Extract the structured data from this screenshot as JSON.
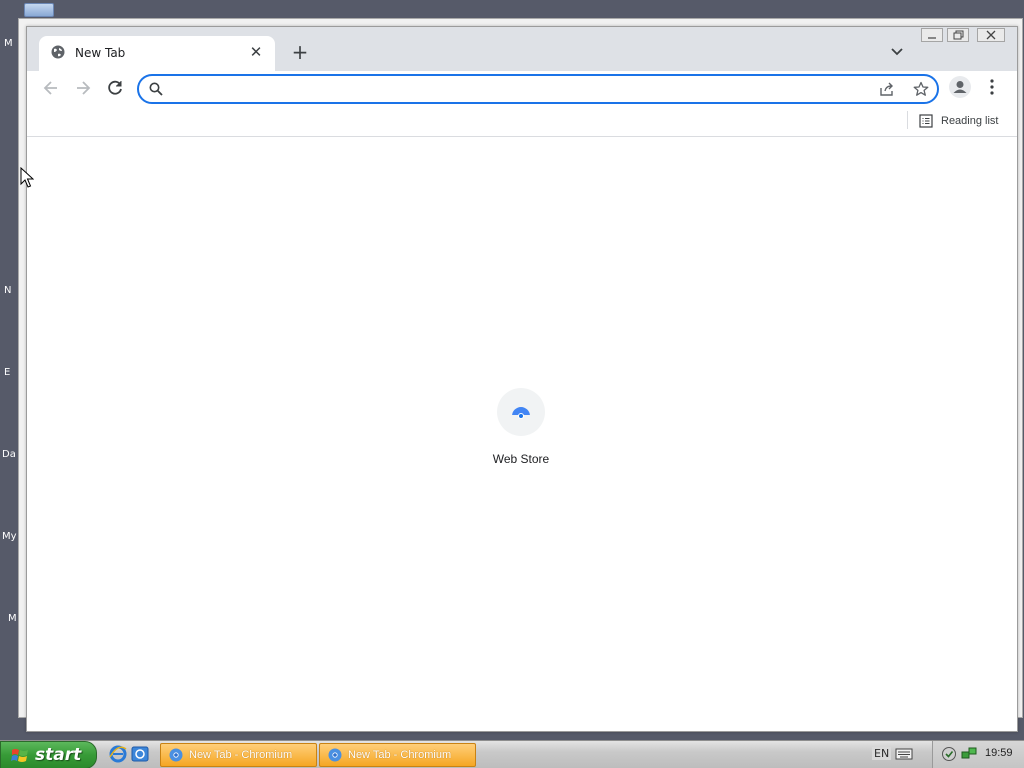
{
  "desktop": {
    "icon_labels": [
      "M",
      "N",
      "E",
      "Da",
      "My",
      "M"
    ]
  },
  "browser": {
    "tab": {
      "title": "New Tab",
      "close_symbol": "✕"
    },
    "new_tab_symbol": "+",
    "omnibox": {
      "value": "",
      "placeholder": ""
    },
    "bookmarks_bar": {
      "reading_list_label": "Reading list"
    },
    "shortcuts": [
      {
        "label": "Web Store"
      }
    ],
    "accent_color": "#1a73e8"
  },
  "taskbar": {
    "start_label": "start",
    "tasks": [
      {
        "label": "New Tab - Chromium"
      },
      {
        "label": "New Tab - Chromium"
      }
    ],
    "language": "EN",
    "clock": "19:59"
  }
}
